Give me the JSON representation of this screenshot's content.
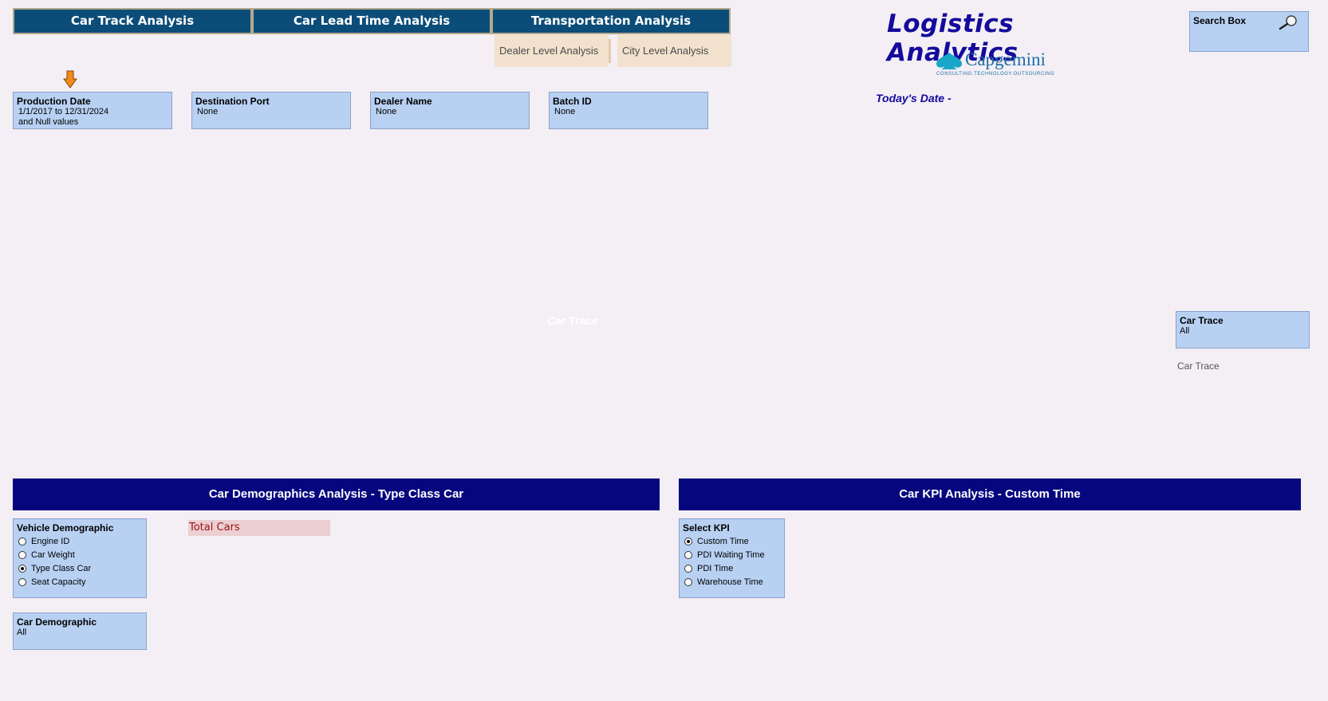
{
  "nav": {
    "tabs": [
      "Car Track Analysis",
      "Car Lead Time Analysis",
      "Transportation Analysis"
    ],
    "subtabs": [
      "Dealer Level Analysis",
      "City Level Analysis"
    ]
  },
  "header": {
    "title": "Logistics Analytics",
    "brand": "Capgemini",
    "brand_tagline": "CONSULTING.TECHNOLOGY.OUTSOURCING",
    "todays_date_label": "Today's Date -"
  },
  "search": {
    "label": "Search Box"
  },
  "filters": [
    {
      "title": "Production Date",
      "lines": [
        "1/1/2017 to 12/31/2024",
        "and Null values"
      ]
    },
    {
      "title": "Destination Port",
      "lines": [
        "None"
      ]
    },
    {
      "title": "Dealer Name",
      "lines": [
        "None"
      ]
    },
    {
      "title": "Batch ID",
      "lines": [
        "None"
      ]
    }
  ],
  "car_trace": {
    "center_label": "Car Trace",
    "box_title": "Car Trace",
    "box_value": "All",
    "caption": "Car Trace"
  },
  "demographics": {
    "section_title": "Car Demographics Analysis - Type Class Car",
    "vehicle_box_title": "Vehicle Demographic",
    "options": [
      "Engine ID",
      "Car Weight",
      "Type Class Car",
      "Seat Capacity"
    ],
    "selected_index": 2,
    "car_demo_title": "Car Demographic",
    "car_demo_value": "All",
    "total_cars_label": "Total Cars"
  },
  "kpi": {
    "section_title": "Car KPI Analysis - Custom Time",
    "box_title": "Select KPI",
    "options": [
      "Custom Time",
      "PDI Waiting Time",
      "PDI Time",
      "Warehouse Time"
    ],
    "selected_index": 0
  },
  "colors": {
    "tab_bg": "#0b4d78",
    "section_bg": "#06077e",
    "listbox_bg": "#b8d1f3",
    "title_color": "#140a9c",
    "arrow": "#f28a1a"
  }
}
